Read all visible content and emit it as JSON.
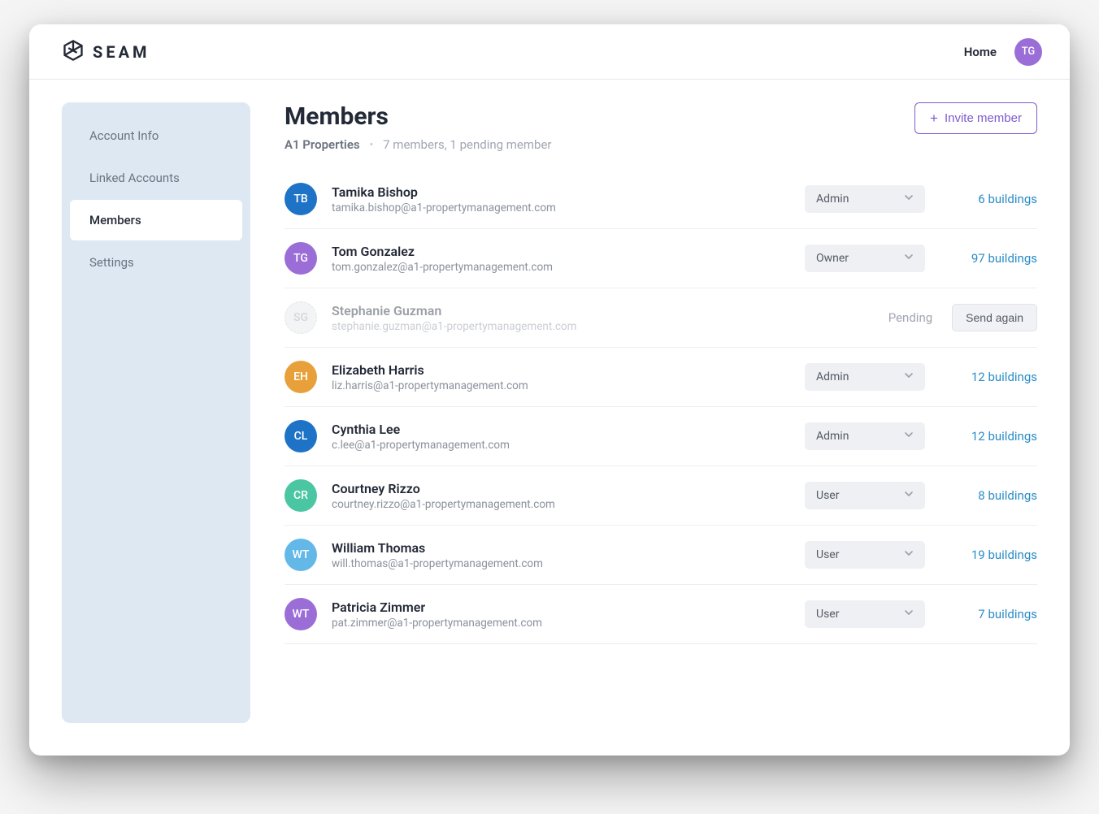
{
  "brand": {
    "name": "SEAM"
  },
  "header": {
    "home_label": "Home",
    "user_initials": "TG"
  },
  "sidebar": {
    "items": [
      {
        "label": "Account Info"
      },
      {
        "label": "Linked Accounts"
      },
      {
        "label": "Members"
      },
      {
        "label": "Settings"
      }
    ]
  },
  "page": {
    "title": "Members",
    "org_name": "A1 Properties",
    "subtitle_stats": "7 members, 1 pending member",
    "invite_button_label": "Invite member"
  },
  "pending_label": "Pending",
  "send_again_label": "Send again",
  "members": [
    {
      "initials": "TB",
      "name": "Tamika Bishop",
      "email": "tamika.bishop@a1-propertymanagement.com",
      "role": "Admin",
      "buildings_text": "6 buildings",
      "avatar_color": "#1e73c7",
      "pending": false
    },
    {
      "initials": "TG",
      "name": "Tom Gonzalez",
      "email": "tom.gonzalez@a1-propertymanagement.com",
      "role": "Owner",
      "buildings_text": "97 buildings",
      "avatar_color": "#9b6dd7",
      "pending": false
    },
    {
      "initials": "SG",
      "name": "Stephanie Guzman",
      "email": "stephanie.guzman@a1-propertymanagement.com",
      "role": "",
      "buildings_text": "",
      "avatar_color": "#e5e7eb",
      "pending": true
    },
    {
      "initials": "EH",
      "name": "Elizabeth Harris",
      "email": "liz.harris@a1-propertymanagement.com",
      "role": "Admin",
      "buildings_text": "12 buildings",
      "avatar_color": "#e8a13a",
      "pending": false
    },
    {
      "initials": "CL",
      "name": "Cynthia Lee",
      "email": "c.lee@a1-propertymanagement.com",
      "role": "Admin",
      "buildings_text": "12 buildings",
      "avatar_color": "#1e73c7",
      "pending": false
    },
    {
      "initials": "CR",
      "name": "Courtney Rizzo",
      "email": "courtney.rizzo@a1-propertymanagement.com",
      "role": "User",
      "buildings_text": "8 buildings",
      "avatar_color": "#4bc6a2",
      "pending": false
    },
    {
      "initials": "WT",
      "name": "William Thomas",
      "email": "will.thomas@a1-propertymanagement.com",
      "role": "User",
      "buildings_text": "19 buildings",
      "avatar_color": "#63b8e8",
      "pending": false
    },
    {
      "initials": "WT",
      "name": "Patricia Zimmer",
      "email": "pat.zimmer@a1-propertymanagement.com",
      "role": "User",
      "buildings_text": "7 buildings",
      "avatar_color": "#9b6dd7",
      "pending": false
    }
  ]
}
